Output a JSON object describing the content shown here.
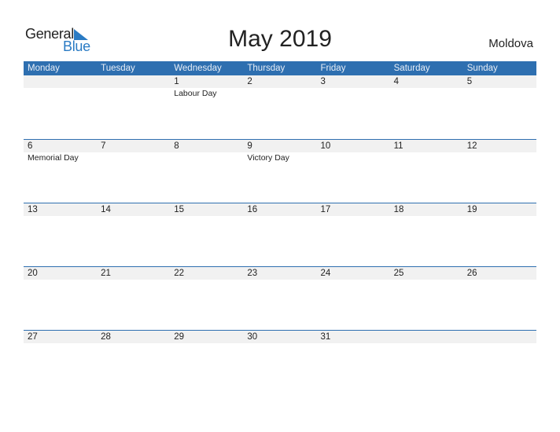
{
  "logo": {
    "word1": "General",
    "word2": "Blue"
  },
  "header": {
    "title": "May 2019",
    "country": "Moldova"
  },
  "colors": {
    "accent": "#2e6fb0",
    "logo_blue": "#2a7bc4",
    "date_band": "#f1f1f1"
  },
  "weekdays": [
    "Monday",
    "Tuesday",
    "Wednesday",
    "Thursday",
    "Friday",
    "Saturday",
    "Sunday"
  ],
  "weeks": [
    {
      "days": [
        "",
        "",
        "1",
        "2",
        "3",
        "4",
        "5"
      ],
      "holidays": [
        "",
        "",
        "Labour Day",
        "",
        "",
        "",
        ""
      ]
    },
    {
      "days": [
        "6",
        "7",
        "8",
        "9",
        "10",
        "11",
        "12"
      ],
      "holidays": [
        "Memorial Day",
        "",
        "",
        "Victory Day",
        "",
        "",
        ""
      ]
    },
    {
      "days": [
        "13",
        "14",
        "15",
        "16",
        "17",
        "18",
        "19"
      ],
      "holidays": [
        "",
        "",
        "",
        "",
        "",
        "",
        ""
      ]
    },
    {
      "days": [
        "20",
        "21",
        "22",
        "23",
        "24",
        "25",
        "26"
      ],
      "holidays": [
        "",
        "",
        "",
        "",
        "",
        "",
        ""
      ]
    },
    {
      "days": [
        "27",
        "28",
        "29",
        "30",
        "31",
        "",
        ""
      ],
      "holidays": [
        "",
        "",
        "",
        "",
        "",
        "",
        ""
      ]
    }
  ]
}
